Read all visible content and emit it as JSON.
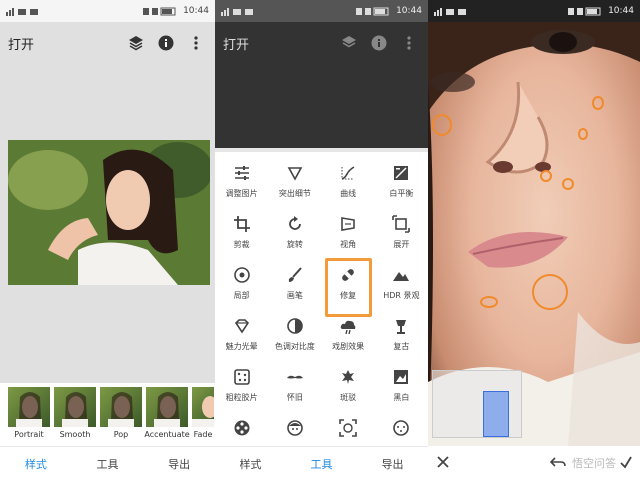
{
  "status_bar": {
    "time": "10:44"
  },
  "editor": {
    "title": "打开",
    "filters": [
      {
        "label": "Portrait"
      },
      {
        "label": "Smooth"
      },
      {
        "label": "Pop"
      },
      {
        "label": "Accentuate"
      },
      {
        "label": "Fade"
      }
    ],
    "tabs": {
      "styles": "样式",
      "tools": "工具",
      "export": "导出"
    }
  },
  "tools_screen": {
    "title": "打开",
    "tools": [
      {
        "label": "调整图片",
        "icon": "tune-icon"
      },
      {
        "label": "突出细节",
        "icon": "details-icon"
      },
      {
        "label": "曲线",
        "icon": "curves-icon"
      },
      {
        "label": "白平衡",
        "icon": "white-balance-icon"
      },
      {
        "label": "剪裁",
        "icon": "crop-icon"
      },
      {
        "label": "旋转",
        "icon": "rotate-icon"
      },
      {
        "label": "视角",
        "icon": "perspective-icon"
      },
      {
        "label": "展开",
        "icon": "expand-icon"
      },
      {
        "label": "局部",
        "icon": "selective-icon"
      },
      {
        "label": "画笔",
        "icon": "brush-icon"
      },
      {
        "label": "修复",
        "icon": "healing-icon",
        "highlighted": true
      },
      {
        "label": "HDR 景观",
        "icon": "hdr-icon"
      },
      {
        "label": "魅力光晕",
        "icon": "glamour-glow-icon"
      },
      {
        "label": "色调对比度",
        "icon": "tonal-contrast-icon"
      },
      {
        "label": "戏剧效果",
        "icon": "drama-icon"
      },
      {
        "label": "复古",
        "icon": "vintage-icon"
      },
      {
        "label": "粗粒胶片",
        "icon": "grainy-film-icon"
      },
      {
        "label": "怀旧",
        "icon": "retrolux-icon"
      },
      {
        "label": "斑驳",
        "icon": "grunge-icon"
      },
      {
        "label": "黑白",
        "icon": "black-white-icon"
      },
      {
        "label": "",
        "icon": "film-reel-icon"
      },
      {
        "label": "",
        "icon": "face-icon"
      },
      {
        "label": "",
        "icon": "face-frame-icon"
      },
      {
        "label": "",
        "icon": "frames-icon"
      }
    ],
    "tabs": {
      "styles": "样式",
      "tools": "工具",
      "export": "导出"
    }
  },
  "healing_screen": {
    "close_icon": "close-icon",
    "undo_icon": "undo-icon",
    "confirm_icon": "check-icon",
    "watermark": "悟空问答",
    "accent_color": "#f08a2b"
  }
}
